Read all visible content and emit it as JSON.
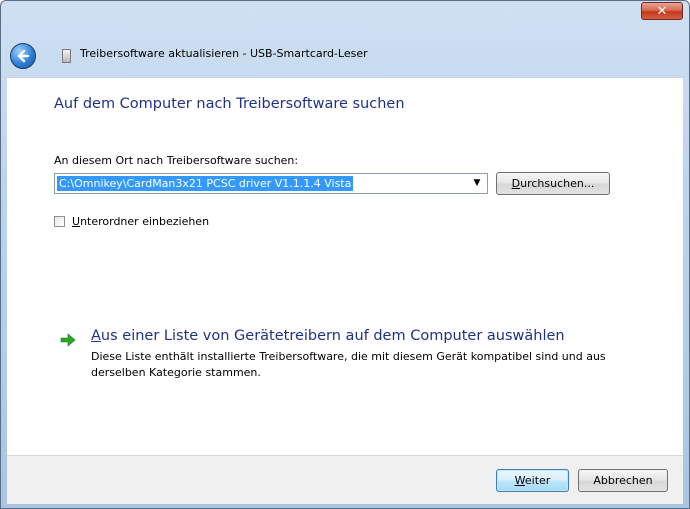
{
  "window": {
    "title": "Treibersoftware aktualisieren - USB-Smartcard-Leser",
    "close_glyph": "✕"
  },
  "page": {
    "heading": "Auf dem Computer nach Treibersoftware suchen",
    "search_label": "An diesem Ort nach Treibersoftware suchen:",
    "path_value": "C:\\Omnikey\\CardMan3x21 PCSC driver V1.1.1.4 Vista",
    "browse": {
      "mnemonic": "D",
      "rest": "urchsuchen..."
    },
    "include_subfolders": {
      "checked": false,
      "mnemonic": "U",
      "rest": "nterordner einbeziehen"
    },
    "list_option": {
      "title_mnemonic": "A",
      "title_rest": "us einer Liste von Gerätetreibern auf dem Computer auswählen",
      "description": "Diese Liste enthält installierte Treibersoftware, die mit diesem Gerät kompatibel sind und aus derselben Kategorie stammen."
    }
  },
  "footer": {
    "next": {
      "mnemonic": "W",
      "rest": "eiter"
    },
    "cancel_label": "Abbrechen"
  },
  "icons": {
    "back": "back-arrow-icon",
    "device": "usb-device-icon",
    "link": "green-arrow-icon"
  },
  "colors": {
    "heading": "#1e3287",
    "selection": "#3399ff",
    "link_arrow": "#2aa52a",
    "close_button": "#c2391e"
  }
}
